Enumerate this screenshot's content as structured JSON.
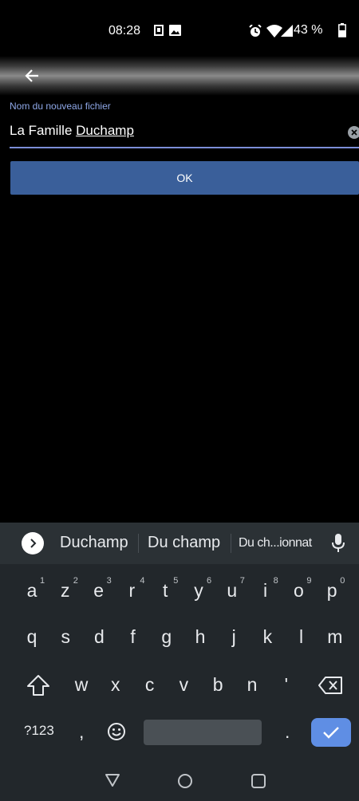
{
  "status_bar": {
    "time": "08:28",
    "battery": "43 %"
  },
  "app_bar": {
    "back_icon": "arrow-back-icon"
  },
  "form": {
    "label": "Nom du nouveau fichier",
    "value_plain": "La Famille ",
    "value_underlined": "Duchamp",
    "ok_label": "OK"
  },
  "keyboard": {
    "suggestions": [
      "Duchamp",
      "Du champ",
      "Du ch...ionnat"
    ],
    "row1": [
      {
        "key": "a",
        "hint": "1"
      },
      {
        "key": "z",
        "hint": "2"
      },
      {
        "key": "e",
        "hint": "3"
      },
      {
        "key": "r",
        "hint": "4"
      },
      {
        "key": "t",
        "hint": "5"
      },
      {
        "key": "y",
        "hint": "6"
      },
      {
        "key": "u",
        "hint": "7"
      },
      {
        "key": "i",
        "hint": "8"
      },
      {
        "key": "o",
        "hint": "9"
      },
      {
        "key": "p",
        "hint": "0"
      }
    ],
    "row2": [
      "q",
      "s",
      "d",
      "f",
      "g",
      "h",
      "j",
      "k",
      "l",
      "m"
    ],
    "row3": [
      "w",
      "x",
      "c",
      "v",
      "b",
      "n",
      "'"
    ],
    "symbols_label": "?123",
    "comma": ",",
    "period": "."
  },
  "colors": {
    "accent": "#3a5f9a",
    "label": "#8fa8e8",
    "enter": "#5f8ee4",
    "keyboard_bg": "#22272b"
  }
}
